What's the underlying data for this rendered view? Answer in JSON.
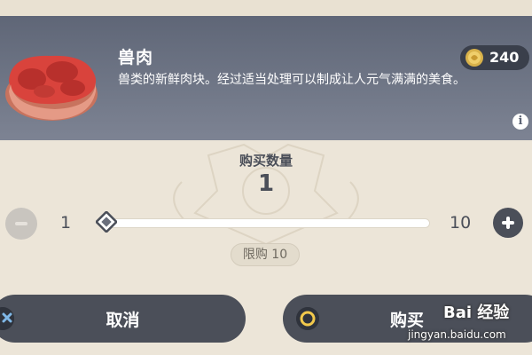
{
  "item": {
    "name": "兽肉",
    "description": "兽类的新鲜肉块。经过适当处理可以制成让人元气满满的美食。",
    "icon": "raw-meat-icon"
  },
  "currency": {
    "value": "240",
    "icon": "mora-coin-icon",
    "color": "#d9b24a"
  },
  "info_icon_label": "i",
  "quantity": {
    "label": "购买数量",
    "value": "1",
    "min": "1",
    "max": "10",
    "slider_fraction": 0,
    "limit_text": "限购 10"
  },
  "buttons": {
    "cancel_label": "取消",
    "cancel_icon": "x-icon",
    "buy_label": "购买",
    "buy_icon": "circle-icon"
  },
  "watermark": {
    "brand": "Bai 经验",
    "url": "jingyan.baidu.com"
  },
  "colors": {
    "panel": "#5f6677",
    "background": "#ece5d8",
    "button": "#4b4f59",
    "meat": "#c9473f"
  }
}
